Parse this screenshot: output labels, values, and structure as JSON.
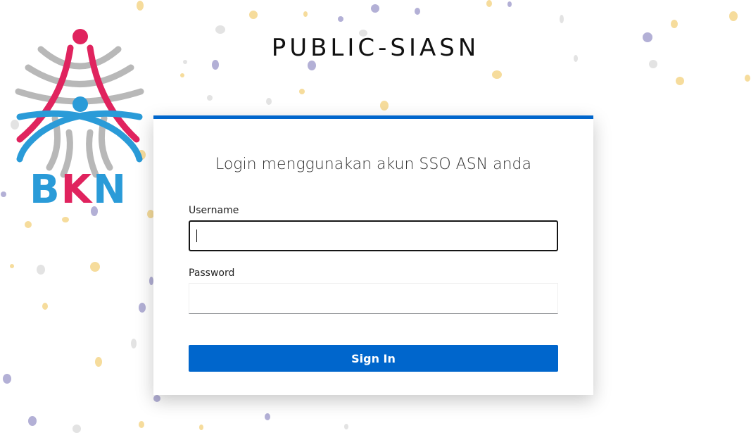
{
  "app": {
    "title": "PUBLIC-SIASN"
  },
  "logo": {
    "letters": [
      "B",
      "K",
      "N"
    ],
    "icon": "bkn-logo-icon",
    "colors": {
      "red": "#e0235e",
      "blue": "#2a9bd8",
      "gray": "#b8b8b8"
    }
  },
  "login": {
    "heading": "Login menggunakan akun SSO ASN anda",
    "username_label": "Username",
    "username_value": "",
    "password_label": "Password",
    "password_value": "",
    "signin_label": "Sign In"
  },
  "theme": {
    "accent": "#0066cc",
    "confetti_colors": [
      "#f5d48a",
      "#b3b0d6",
      "#e0e0e0"
    ]
  }
}
